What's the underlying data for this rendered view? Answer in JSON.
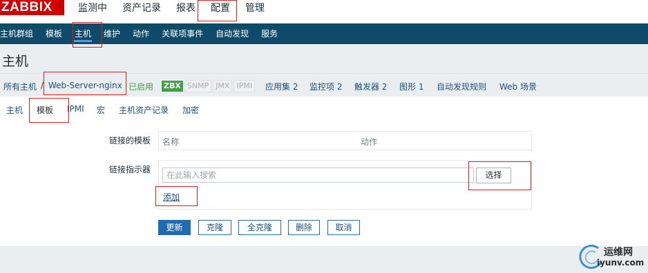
{
  "logo": "ZABBIX",
  "topmenu": [
    "监测中",
    "资产记录",
    "报表",
    "配置",
    "管理"
  ],
  "submenu": [
    "主机群组",
    "模板",
    "主机",
    "维护",
    "动作",
    "关联项事件",
    "自动发现",
    "服务"
  ],
  "page_title": "主机",
  "breadcrumb": {
    "all_hosts": "所有主机",
    "sep": "/",
    "host": "Web-Server-nginx",
    "status": "已启用",
    "pills": [
      "ZBX",
      "SNMP",
      "JMX",
      "IPMI"
    ],
    "links": [
      "应用集 2",
      "监控项 2",
      "触发器 2",
      "图形 1",
      "自动发现规则",
      "Web 场景"
    ]
  },
  "tabs": [
    "主机",
    "模板",
    "IPMI",
    "宏",
    "主机资产记录",
    "加密"
  ],
  "form": {
    "linked_label": "链接的模板",
    "col_name": "名称",
    "col_action": "动作",
    "link_label": "链接指示器",
    "search_placeholder": "在此输入搜索",
    "select_button": "选择",
    "add_link": "添加"
  },
  "buttons": [
    "更新",
    "克隆",
    "全克隆",
    "删除",
    "取消"
  ],
  "watermark": {
    "line1": "运维网",
    "line2": "iyunv.com"
  },
  "colors": {
    "brand": "#d40000",
    "nav": "#104a6a",
    "primary": "#1f6cb5",
    "enabled": "#429e47",
    "highlight": "#e01b1b"
  }
}
